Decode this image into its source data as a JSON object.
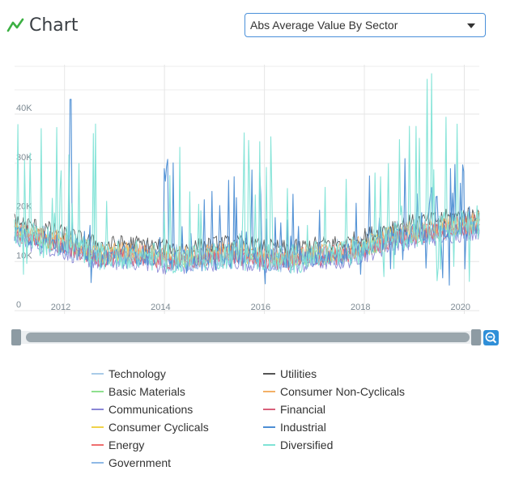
{
  "header": {
    "title": "Chart",
    "icon": "line-chart-icon",
    "icon_color": "#3cb043"
  },
  "selector": {
    "value": "Abs Average Value By Sector",
    "icon": "dropdown-caret-icon"
  },
  "zoom_button": {
    "icon": "zoom-out-icon"
  },
  "chart_data": {
    "type": "line",
    "title": "",
    "xlabel": "",
    "ylabel": "",
    "x_ticks": [
      "2012",
      "2014",
      "2016",
      "2018",
      "2020"
    ],
    "y_ticks": [
      "0",
      "10K",
      "20K",
      "30K",
      "40K"
    ],
    "xlim": [
      2011.0,
      2020.3
    ],
    "ylim": [
      0,
      50000
    ],
    "grid": true,
    "legend_position": "bottom",
    "series": [
      {
        "name": "Technology",
        "color": "#a9cbe8",
        "profile": "noisy-base",
        "offset": 600
      },
      {
        "name": "Basic Materials",
        "color": "#8ee08e",
        "profile": "base",
        "offset": -300
      },
      {
        "name": "Communications",
        "color": "#8a86d6",
        "profile": "base",
        "offset": -1500
      },
      {
        "name": "Consumer Cyclicals",
        "color": "#f0d24a",
        "profile": "base",
        "offset": 0
      },
      {
        "name": "Energy",
        "color": "#ef6f6f",
        "profile": "base",
        "offset": 400
      },
      {
        "name": "Government",
        "color": "#8fb9e6",
        "profile": "base",
        "offset": -900
      },
      {
        "name": "Utilities",
        "color": "#555555",
        "profile": "base",
        "offset": 2200
      },
      {
        "name": "Consumer Non-Cyclicals",
        "color": "#f3b066",
        "profile": "base",
        "offset": 900
      },
      {
        "name": "Financial",
        "color": "#d9607a",
        "profile": "base",
        "offset": -600
      },
      {
        "name": "Industrial",
        "color": "#4d8ed4",
        "profile": "spiky-industrial",
        "offset": 0
      },
      {
        "name": "Diversified",
        "color": "#7fe3d6",
        "profile": "spiky-diversified",
        "offset": 0
      }
    ]
  },
  "legend": {
    "items": [
      {
        "label": "Technology",
        "color": "#a9cbe8"
      },
      {
        "label": "Basic Materials",
        "color": "#8ee08e"
      },
      {
        "label": "Communications",
        "color": "#8a86d6"
      },
      {
        "label": "Consumer Cyclicals",
        "color": "#f0d24a"
      },
      {
        "label": "Energy",
        "color": "#ef6f6f"
      },
      {
        "label": "Government",
        "color": "#8fb9e6"
      },
      {
        "label": "Utilities",
        "color": "#555555"
      },
      {
        "label": "Consumer Non-Cyclicals",
        "color": "#f3b066"
      },
      {
        "label": "Financial",
        "color": "#d9607a"
      },
      {
        "label": "Industrial",
        "color": "#4d8ed4"
      },
      {
        "label": "Diversified",
        "color": "#7fe3d6"
      }
    ]
  }
}
